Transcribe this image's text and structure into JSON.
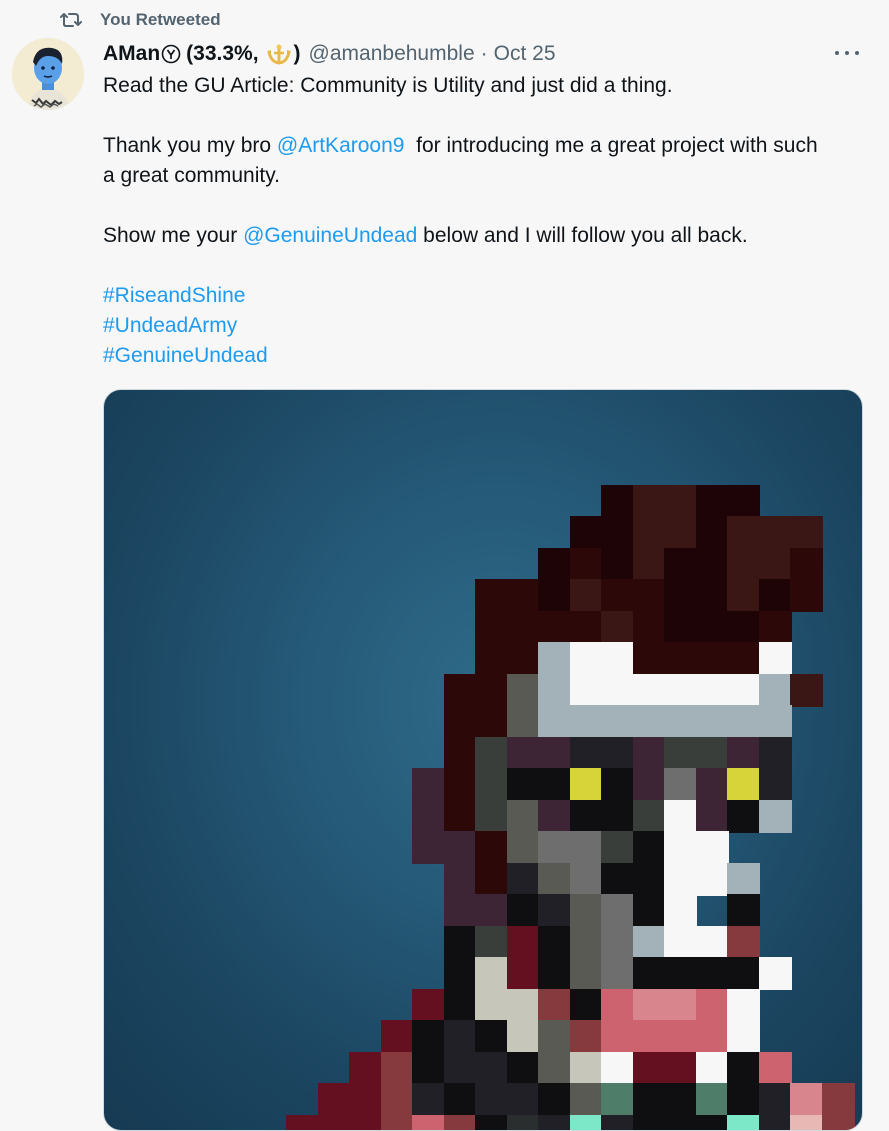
{
  "retweet": {
    "label": "You Retweeted",
    "icon": "retweet-icon"
  },
  "tweet": {
    "author": {
      "name_prefix": "AMan",
      "name_middle": "(33.3%,",
      "name_suffix": ")",
      "handle": "@amanbehumble",
      "separator": "·",
      "date": "Oct 25"
    },
    "text": {
      "line1": "Read the GU Article: Community is Utility and just did a thing.",
      "p2_start": "Thank you my bro ",
      "mention_artkaroon": "@ArtKaroon9",
      "p2_end": "  for introducing me a great project with such a great community.",
      "p3_start": "Show me your ",
      "mention_genuineundead": "@GenuineUndead",
      "p3_end": " below and I will follow you all back.",
      "hashtags": [
        "#RiseandShine",
        "#UndeadArmy",
        "#GenuineUndead"
      ]
    },
    "colors": {
      "link": "#1d9bf0",
      "muted": "#536471",
      "text": "#0f1419"
    }
  }
}
